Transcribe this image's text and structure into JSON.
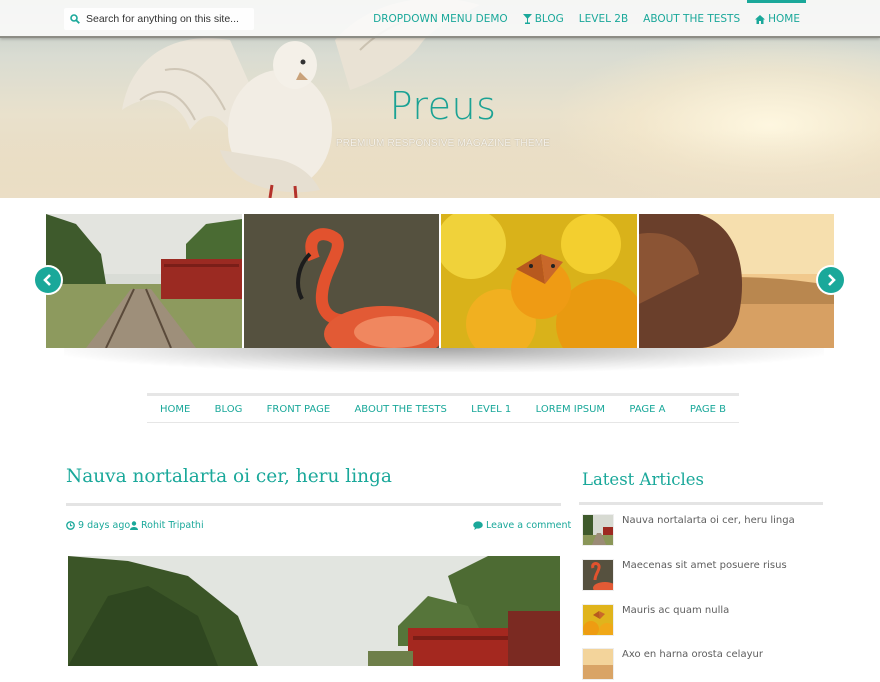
{
  "header": {
    "search_placeholder": "Search for anything on this site...",
    "nav": [
      {
        "label": "DROPDOWN MENU DEMO",
        "icon": ""
      },
      {
        "label": "BLOG",
        "icon": "glass-icon"
      },
      {
        "label": "LEVEL 2B",
        "icon": ""
      },
      {
        "label": "ABOUT THE TESTS",
        "icon": ""
      },
      {
        "label": "HOME",
        "icon": "home-icon",
        "active": true
      }
    ],
    "site_title": "Preus",
    "tagline": "PREMIUM RESPONSIVE MAGAZINE THEME"
  },
  "slider": {
    "slides": [
      "railway-tracks-image",
      "flamingo-image",
      "butterfly-flower-image",
      "woman-sunset-image"
    ]
  },
  "main_nav": [
    "HOME",
    "BLOG",
    "FRONT PAGE",
    "ABOUT THE TESTS",
    "LEVEL 1",
    "LOREM IPSUM",
    "PAGE A",
    "PAGE B"
  ],
  "post": {
    "title": "Nauva nortalarta oi cer, heru linga",
    "date": "9 days ago",
    "author": "Rohit Tripathi",
    "comments": "Leave a comment"
  },
  "sidebar": {
    "widget_title": "Latest Articles",
    "articles": [
      {
        "title": "Nauva nortalarta oi cer, heru linga"
      },
      {
        "title": "Maecenas sit amet posuere risus"
      },
      {
        "title": "Mauris ac quam nulla"
      },
      {
        "title": "Axo en harna orosta celayur"
      }
    ]
  },
  "colors": {
    "accent": "#1aa89a",
    "text": "#5e5e5e",
    "rule": "#e4e4e4"
  }
}
